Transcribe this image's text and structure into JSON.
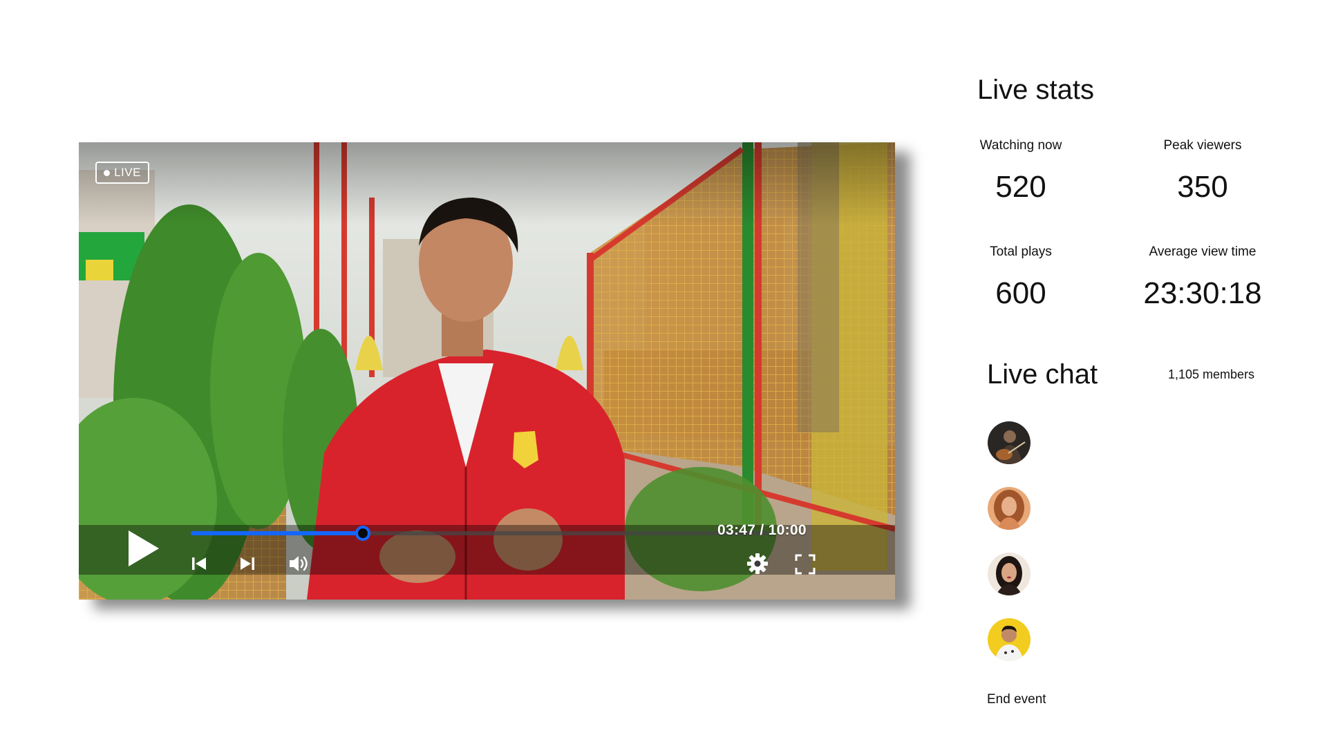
{
  "player": {
    "live_label": "LIVE",
    "time_display": "03:47 / 10:00",
    "progress": 0.297,
    "icons": {
      "play": "play-icon",
      "previous": "skip-previous-icon",
      "next": "skip-next-icon",
      "volume": "volume-icon",
      "settings": "gear-icon",
      "fullscreen": "fullscreen-icon"
    },
    "accent_color": "#1466ff"
  },
  "stats": {
    "title": "Live stats",
    "watching_now": {
      "label": "Watching now",
      "value": "520"
    },
    "peak_viewers": {
      "label": "Peak viewers",
      "value": "350"
    },
    "total_plays": {
      "label": "Total plays",
      "value": "600"
    },
    "average_view_time": {
      "label": "Average view time",
      "value": "23:30:18"
    }
  },
  "chat": {
    "title": "Live chat",
    "members": "1,105 members",
    "participants": [
      {
        "avatar": "avatar-guitarist"
      },
      {
        "avatar": "avatar-woman-curly-hair"
      },
      {
        "avatar": "avatar-woman-dark-hair"
      },
      {
        "avatar": "avatar-man-yellow-background"
      }
    ]
  },
  "actions": {
    "end_event": "End event"
  }
}
